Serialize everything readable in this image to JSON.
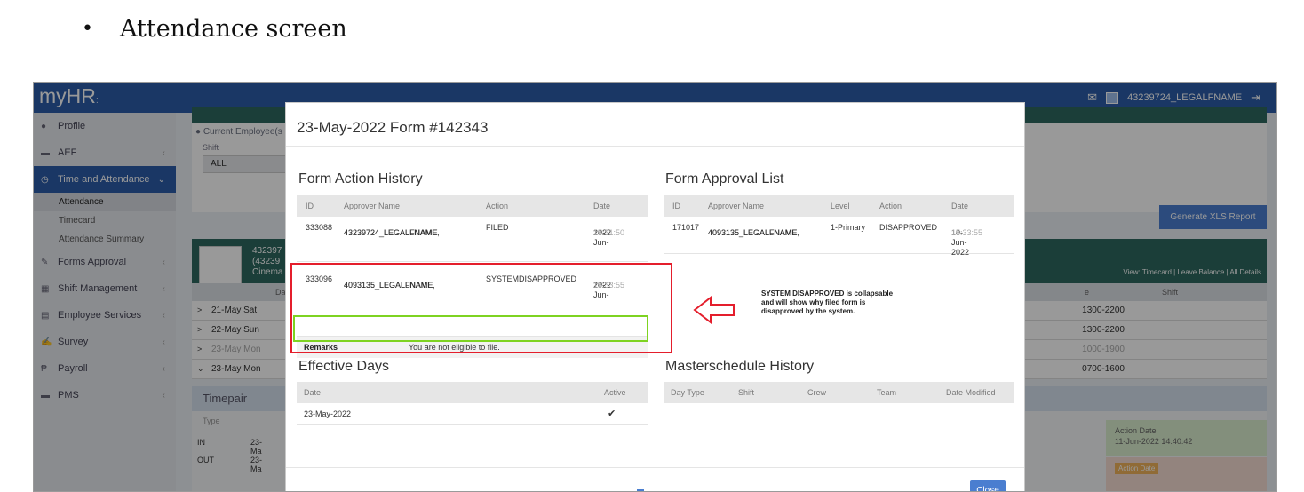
{
  "doc": {
    "bullet": "•",
    "heading": "Attendance screen"
  },
  "app": {
    "brand": "myHR",
    "brand_sub": ":",
    "topbar": {
      "mail_icon": "envelope-icon",
      "user": "43239724_LEGALFNAME",
      "logout_icon": "logout-icon"
    }
  },
  "sidebar": {
    "items": [
      {
        "label": "Profile",
        "icon": "user-icon"
      },
      {
        "label": "AEF",
        "icon": "folder-icon",
        "chev": "‹"
      },
      {
        "label": "Time and Attendance",
        "icon": "clock-icon",
        "chev": "⌄"
      },
      {
        "label": "Forms Approval",
        "icon": "pencil-icon",
        "chev": "‹"
      },
      {
        "label": "Shift Management",
        "icon": "calendar-icon",
        "chev": "‹"
      },
      {
        "label": "Employee Services",
        "icon": "document-icon",
        "chev": "‹"
      },
      {
        "label": "Survey",
        "icon": "edit-icon",
        "chev": "‹"
      },
      {
        "label": "Payroll",
        "icon": "peso-icon",
        "chev": "‹"
      },
      {
        "label": "PMS",
        "icon": "folder-icon",
        "chev": "‹"
      }
    ],
    "subitems": [
      "Attendance",
      "Timecard",
      "Attendance Summary"
    ]
  },
  "background": {
    "radio_label": "Current Employee(s",
    "shift_label": "Shift",
    "shift_value": "ALL",
    "generate_button": "Generate XLS Report",
    "employee_id_1": "432397",
    "employee_id_2": "(43239",
    "employee_dept": "Cinema",
    "view_links": "View: Timecard | Leave Balance | All Details",
    "col_day": "Da",
    "col_shift": "Shift",
    "col_e": "e",
    "days": [
      {
        "caret": ">",
        "label": "21-May Sat",
        "shift": "1300-2200",
        "muted": false
      },
      {
        "caret": ">",
        "label": "22-May Sun",
        "shift": "1300-2200",
        "muted": false
      },
      {
        "caret": ">",
        "label": "23-May Mon",
        "shift": "1000-1900",
        "muted": true
      },
      {
        "caret": "⌄",
        "label": "23-May Mon",
        "shift": "0700-1600",
        "muted": false
      }
    ],
    "timepair": {
      "title": "Timepair",
      "type_header": "Type",
      "rows": [
        {
          "type": "IN",
          "value": "23-Ma"
        },
        {
          "type": "OUT",
          "value": "23-Ma"
        }
      ],
      "action_date_label": "Action Date",
      "action_date_value": "11-Jun-2022 14:40:42",
      "pink_tag": "Action Date"
    }
  },
  "modal": {
    "title": "23-May-2022 Form #142343",
    "action_history": {
      "title": "Form Action History",
      "headers": [
        "ID",
        "Approver Name",
        "Action",
        "Date"
      ],
      "rows": [
        {
          "id": "333088",
          "name1": "43239724_LEGALLNAME,",
          "name2": "43239724_LEGALFNAME",
          "action": "FILED",
          "date1": "10-Jun-",
          "date2": "2022",
          "time": "15:31:50"
        },
        {
          "id": "333096",
          "name1": "4093135_LEGALLNAME,",
          "name2": "4093135_LEGALFNAME",
          "action": "SYSTEMDISAPPROVED",
          "date1": "10-Jun-",
          "date2": "2022",
          "time": "15:33:55"
        }
      ],
      "remarks_label": "Remarks",
      "remarks_value": "You are not eligible to file."
    },
    "approval_list": {
      "title": "Form Approval List",
      "headers": [
        "ID",
        "Approver Name",
        "Level",
        "Action",
        "Date"
      ],
      "rows": [
        {
          "id": "171017",
          "name1": "4093135_LEGALLNAME,",
          "name2": "4093135_LEGALFNAME",
          "level": "1-Primary",
          "action": "DISAPPROVED",
          "date": "10-Jun-2022",
          "time": "15:33:55"
        }
      ]
    },
    "effective_days": {
      "title": "Effective Days",
      "headers": [
        "Date",
        "Active"
      ],
      "rows": [
        {
          "date": "23-May-2022",
          "active": "✔"
        }
      ]
    },
    "masterschedule": {
      "title": "Masterschedule History",
      "headers": [
        "Day Type",
        "Shift",
        "Crew",
        "Team",
        "Date Modified"
      ]
    },
    "close_button": "Close"
  },
  "annotation": {
    "note_line1": "SYSTEM DISAPPROVED is collapsable",
    "note_line2": "and will show why filed form is",
    "note_line3": "disapproved by the system.",
    "red_color": "#e41e2c",
    "green_color": "#7ed321"
  }
}
